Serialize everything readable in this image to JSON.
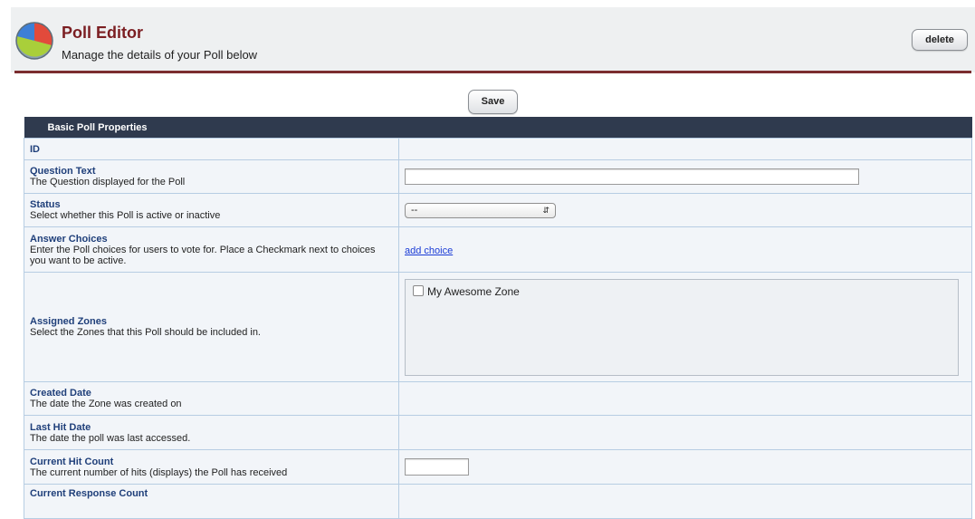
{
  "header": {
    "title": "Poll Editor",
    "subtitle": "Manage the details of your Poll below",
    "delete_label": "delete",
    "logo_icon": "pie-chart-icon"
  },
  "save_label": "Save",
  "section": {
    "title": "Basic Poll Properties"
  },
  "fields": {
    "id": {
      "label": "ID"
    },
    "question": {
      "label": "Question Text",
      "desc": "The Question displayed for the Poll",
      "value": ""
    },
    "status": {
      "label": "Status",
      "desc": "Select whether this Poll is active or inactive",
      "selected": "--"
    },
    "answers": {
      "label": "Answer Choices",
      "desc": "Enter the Poll choices for users to vote for. Place a Checkmark next to choices you want to be active.",
      "link": "add choice"
    },
    "zones": {
      "label": "Assigned Zones",
      "desc": "Select the Zones that this Poll should be included in.",
      "options": [
        {
          "label": "My Awesome Zone",
          "checked": false
        }
      ]
    },
    "created": {
      "label": "Created Date",
      "desc": "The date the Zone was created on"
    },
    "last_hit": {
      "label": "Last Hit Date",
      "desc": "The date the poll was last accessed."
    },
    "hit_count": {
      "label": "Current Hit Count",
      "desc": "The current number of hits (displays) the Poll has received",
      "value": ""
    },
    "response_count": {
      "label": "Current Response Count"
    }
  },
  "colors": {
    "title": "#7b1e22",
    "header_rule": "#7b2d2f",
    "section_bar": "#2f3a4e",
    "label_blue": "#1f3f7a",
    "link": "#1a3bd6"
  }
}
